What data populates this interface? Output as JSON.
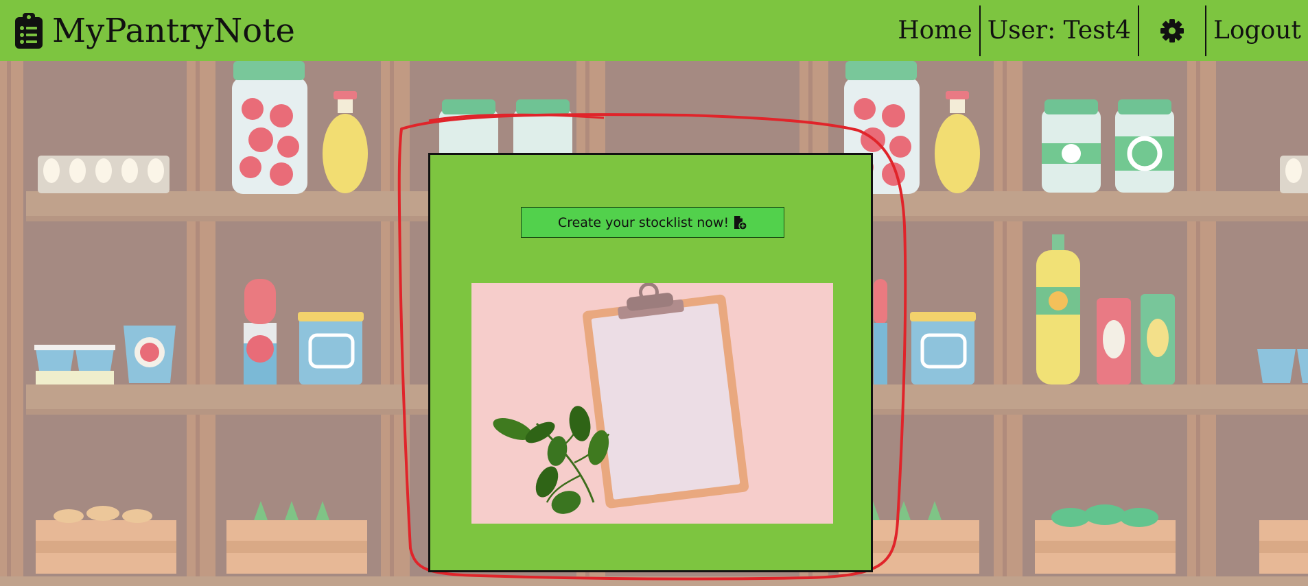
{
  "header": {
    "brand": "MyPantryNote",
    "nav": {
      "home": "Home",
      "user": "User: Test4",
      "logout": "Logout"
    }
  },
  "main": {
    "create_button_label": "Create your stocklist now!"
  },
  "icons": {
    "brand": "clipboard-list-icon",
    "settings": "gear-icon",
    "create": "file-add-icon"
  },
  "colors": {
    "header_bg": "#7dc540",
    "card_bg": "#7dc540",
    "button_bg": "#52d14c",
    "annotation": "#e0242a"
  }
}
